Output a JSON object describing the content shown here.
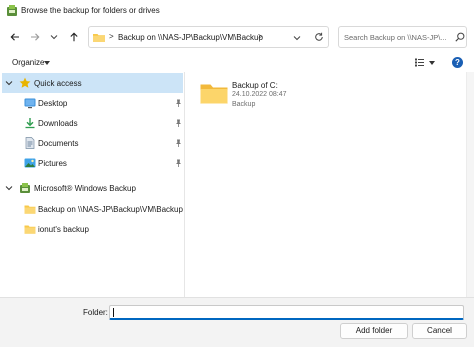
{
  "window": {
    "title": "Browse the backup for folders or drives"
  },
  "address": {
    "path": "Backup on \\\\NAS-JP\\Backup\\VM\\Backup",
    "separator": ">",
    "search_placeholder": "Search Backup on \\\\NAS-JP\\..."
  },
  "toolbar": {
    "organize_label": "Organize"
  },
  "navigation": {
    "quick_access": "Quick access",
    "items": [
      {
        "label": "Desktop",
        "icon": "desktop-icon",
        "pinned": true
      },
      {
        "label": "Downloads",
        "icon": "downloads-icon",
        "pinned": true
      },
      {
        "label": "Documents",
        "icon": "documents-icon",
        "pinned": true
      },
      {
        "label": "Pictures",
        "icon": "pictures-icon",
        "pinned": true
      }
    ],
    "windows_backup": "Microsoft® Windows Backup",
    "backup_items": [
      {
        "label": "Backup on \\\\NAS-JP\\Backup\\VM\\Backup"
      },
      {
        "label": "ionut's backup"
      }
    ]
  },
  "files": [
    {
      "name": "Backup of C:",
      "date": "24.10.2022 08:47",
      "type": "Backup"
    }
  ],
  "footer": {
    "folder_label": "Folder:",
    "folder_value": "",
    "add_button": "Add folder",
    "cancel_button": "Cancel"
  },
  "colors": {
    "accent": "#0067c0",
    "selection": "#cce4f7",
    "folder": "#f8c94a",
    "star": "#e8b400"
  }
}
